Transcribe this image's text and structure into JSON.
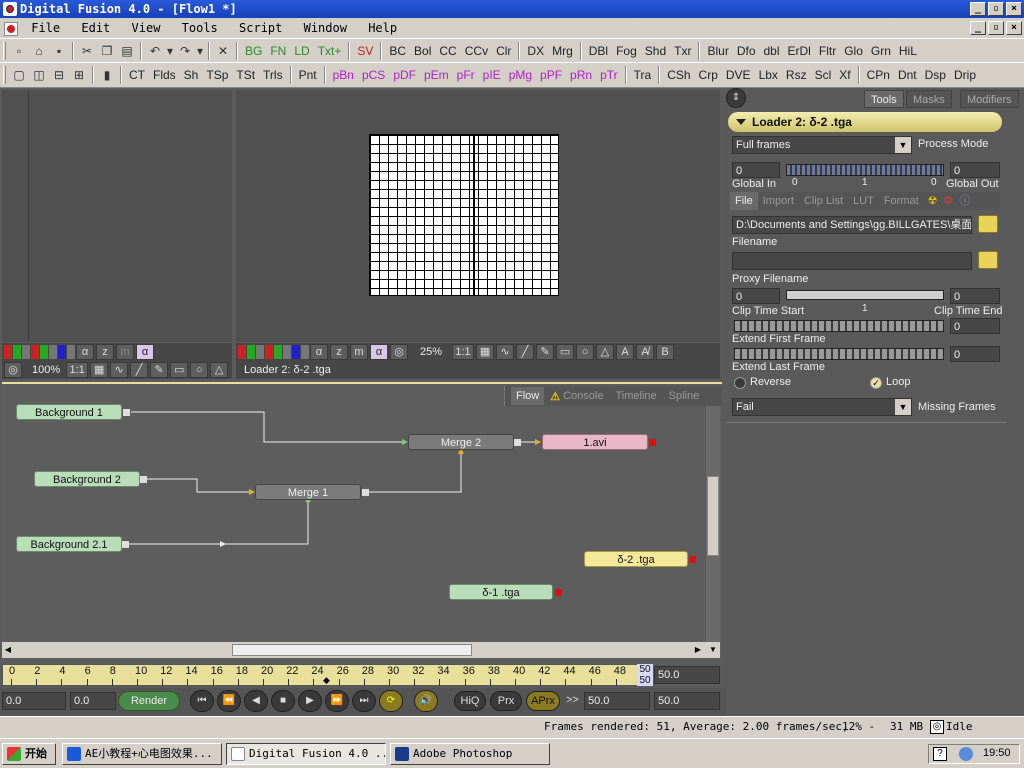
{
  "window": {
    "title": "Digital Fusion 4.0 - [Flow1 *]"
  },
  "menu": [
    "File",
    "Edit",
    "View",
    "Tools",
    "Script",
    "Window",
    "Help"
  ],
  "toolbar1": [
    "BG",
    "FN",
    "LD",
    "Txt+",
    "SV",
    "BC",
    "Bol",
    "CC",
    "CCv",
    "Clr",
    "DX",
    "Mrg",
    "DBl",
    "Fog",
    "Shd",
    "Txr",
    "Blur",
    "Dfo",
    "dbl",
    "ErDl",
    "Fltr",
    "Glo",
    "Grn",
    "HiL"
  ],
  "toolbar2": [
    "CT",
    "Flds",
    "Sh",
    "TSp",
    "TSt",
    "Trls",
    "Pnt",
    "pBn",
    "pCS",
    "pDF",
    "pEm",
    "pFr",
    "pIE",
    "pMg",
    "pPF",
    "pRn",
    "pTr",
    "Tra",
    "CSh",
    "Crp",
    "DVE",
    "Lbx",
    "Rsz",
    "Scl",
    "Xf",
    "CPn",
    "Dnt",
    "Dsp",
    "Drip"
  ],
  "viewer_left": {
    "zoom": "100%",
    "ratio": "1:1"
  },
  "viewer_right": {
    "zoom": "25%",
    "ratio": "1:1",
    "label": "Loader 2: δ-2 .tga"
  },
  "flow_tabs": [
    "Flow",
    "Console",
    "Timeline",
    "Spline"
  ],
  "nodes": {
    "bg1": "Background 1",
    "bg2": "Background 2",
    "bg21": "Background 2.1",
    "merge1": "Merge 1",
    "merge2": "Merge 2",
    "avi": "1.avi",
    "ld2": "δ-2 .tga",
    "ld1": "δ-1 .tga"
  },
  "timeline": {
    "ticks": [
      "0",
      "2",
      "4",
      "6",
      "8",
      "10",
      "12",
      "14",
      "16",
      "18",
      "20",
      "22",
      "24",
      "26",
      "28",
      "30",
      "32",
      "34",
      "36",
      "38",
      "40",
      "42",
      "44",
      "46",
      "48"
    ],
    "end_top": "50",
    "end_bottom": "50",
    "end_value": "50.0",
    "current_time": "0.0",
    "start_value": "0.0",
    "render_label": "Render",
    "render_start": "50.0",
    "render_end": "50.0",
    "hiq": "HiQ",
    "prx": "Prx",
    "aprx": "APrx"
  },
  "panel": {
    "tabs": [
      "Tools",
      "Masks",
      "Modifiers"
    ],
    "title": "Loader 2: δ-2 .tga",
    "process_mode_value": "Full frames",
    "process_mode_label": "Process Mode",
    "global_in_value": "0",
    "global_out_value": "0",
    "global_in_label": "Global In",
    "global_out_label": "Global Out",
    "slider_min": "0",
    "slider_mid": "1",
    "slider_max": "0",
    "subtabs": [
      "File",
      "Import",
      "Clip List",
      "LUT",
      "Format"
    ],
    "filename_value": "D:\\Documents and Settings\\gg.BILLGATES\\桌面\\",
    "filename_label": "Filename",
    "proxy_label": "Proxy Filename",
    "clip_start_value": "0",
    "clip_end_value": "0",
    "clip_mid": "1",
    "clip_start_label": "Clip Time Start",
    "clip_end_label": "Clip Time End",
    "extend_first_value": "0",
    "extend_first_label": "Extend First Frame",
    "extend_last_value": "0",
    "extend_last_label": "Extend Last Frame",
    "reverse_label": "Reverse",
    "loop_label": "Loop",
    "missing_value": "Fail",
    "missing_label": "Missing Frames"
  },
  "status": {
    "frames": "Frames rendered: 51,  Average: 2.00 frames/sec,",
    "cpu": "12% -",
    "mem": "31 MB",
    "state": "Idle"
  },
  "taskbar": {
    "start": "开始",
    "tasks": [
      "AE小教程+心电图效果...",
      "Digital Fusion 4.0 ...",
      "Adobe Photoshop"
    ],
    "clock": "19:50"
  }
}
